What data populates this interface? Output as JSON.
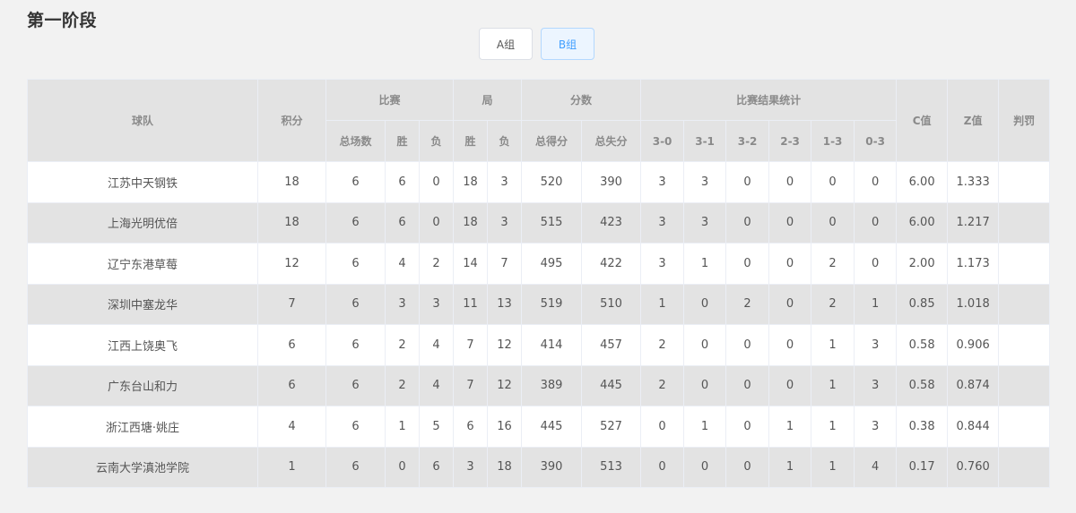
{
  "page": {
    "title": "第一阶段"
  },
  "tabs": [
    {
      "label": "A组",
      "active": false
    },
    {
      "label": "B组",
      "active": true
    }
  ],
  "table": {
    "headers": {
      "team": "球队",
      "points": "积分",
      "matches_group": "比赛",
      "sets_group": "局",
      "scores_group": "分数",
      "results_group": "比赛结果统计",
      "c_value": "C值",
      "z_value": "Z值",
      "penalty": "判罚",
      "sub": {
        "total_matches": "总场数",
        "match_win": "胜",
        "match_loss": "负",
        "set_win": "胜",
        "set_loss": "负",
        "points_for": "总得分",
        "points_against": "总失分",
        "r30": "3-0",
        "r31": "3-1",
        "r32": "3-2",
        "r23": "2-3",
        "r13": "1-3",
        "r03": "0-3"
      }
    },
    "rows": [
      {
        "team": "江苏中天钢铁",
        "points": "18",
        "total": "6",
        "mw": "6",
        "ml": "0",
        "sw": "18",
        "sl": "3",
        "pf": "520",
        "pa": "390",
        "r30": "3",
        "r31": "3",
        "r32": "0",
        "r23": "0",
        "r13": "0",
        "r03": "0",
        "c": "6.00",
        "z": "1.333",
        "penalty": ""
      },
      {
        "team": "上海光明优倍",
        "points": "18",
        "total": "6",
        "mw": "6",
        "ml": "0",
        "sw": "18",
        "sl": "3",
        "pf": "515",
        "pa": "423",
        "r30": "3",
        "r31": "3",
        "r32": "0",
        "r23": "0",
        "r13": "0",
        "r03": "0",
        "c": "6.00",
        "z": "1.217",
        "penalty": ""
      },
      {
        "team": "辽宁东港草莓",
        "points": "12",
        "total": "6",
        "mw": "4",
        "ml": "2",
        "sw": "14",
        "sl": "7",
        "pf": "495",
        "pa": "422",
        "r30": "3",
        "r31": "1",
        "r32": "0",
        "r23": "0",
        "r13": "2",
        "r03": "0",
        "c": "2.00",
        "z": "1.173",
        "penalty": ""
      },
      {
        "team": "深圳中塞龙华",
        "points": "7",
        "total": "6",
        "mw": "3",
        "ml": "3",
        "sw": "11",
        "sl": "13",
        "pf": "519",
        "pa": "510",
        "r30": "1",
        "r31": "0",
        "r32": "2",
        "r23": "0",
        "r13": "2",
        "r03": "1",
        "c": "0.85",
        "z": "1.018",
        "penalty": ""
      },
      {
        "team": "江西上饶奥飞",
        "points": "6",
        "total": "6",
        "mw": "2",
        "ml": "4",
        "sw": "7",
        "sl": "12",
        "pf": "414",
        "pa": "457",
        "r30": "2",
        "r31": "0",
        "r32": "0",
        "r23": "0",
        "r13": "1",
        "r03": "3",
        "c": "0.58",
        "z": "0.906",
        "penalty": ""
      },
      {
        "team": "广东台山和力",
        "points": "6",
        "total": "6",
        "mw": "2",
        "ml": "4",
        "sw": "7",
        "sl": "12",
        "pf": "389",
        "pa": "445",
        "r30": "2",
        "r31": "0",
        "r32": "0",
        "r23": "0",
        "r13": "1",
        "r03": "3",
        "c": "0.58",
        "z": "0.874",
        "penalty": ""
      },
      {
        "team": "浙江西塘·姚庄",
        "points": "4",
        "total": "6",
        "mw": "1",
        "ml": "5",
        "sw": "6",
        "sl": "16",
        "pf": "445",
        "pa": "527",
        "r30": "0",
        "r31": "1",
        "r32": "0",
        "r23": "1",
        "r13": "1",
        "r03": "3",
        "c": "0.38",
        "z": "0.844",
        "penalty": ""
      },
      {
        "team": "云南大学滇池学院",
        "points": "1",
        "total": "6",
        "mw": "0",
        "ml": "6",
        "sw": "3",
        "sl": "18",
        "pf": "390",
        "pa": "513",
        "r30": "0",
        "r31": "0",
        "r32": "0",
        "r23": "1",
        "r13": "1",
        "r03": "4",
        "c": "0.17",
        "z": "0.760",
        "penalty": ""
      }
    ]
  }
}
